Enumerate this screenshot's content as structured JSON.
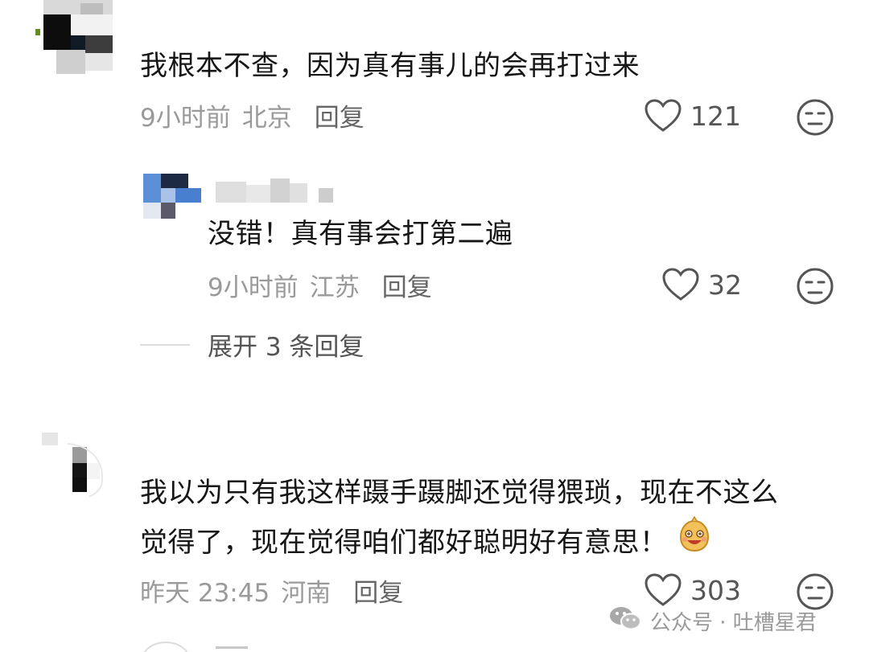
{
  "comments": [
    {
      "text": "我根本不查，因为真有事儿的会再打过来",
      "time": "9小时前",
      "location": "北京",
      "reply_label": "回复",
      "likes": "121"
    },
    {
      "text_line1": "我以为只有我这样蹑手蹑脚还觉得猥琐，现在不这么",
      "text_line2": "觉得了，现在觉得咱们都好聪明好有意思！",
      "time": "昨天 23:45",
      "location": "河南",
      "reply_label": "回复",
      "likes": "303"
    }
  ],
  "reply": {
    "text": "没错！真有事会打第二遍",
    "time": "9小时前",
    "location": "江苏",
    "reply_label": "回复",
    "likes": "32"
  },
  "expand_replies": "展开 3 条回复",
  "watermark": "公众号 · 吐槽星君",
  "partial_bottom": "<u>一"
}
